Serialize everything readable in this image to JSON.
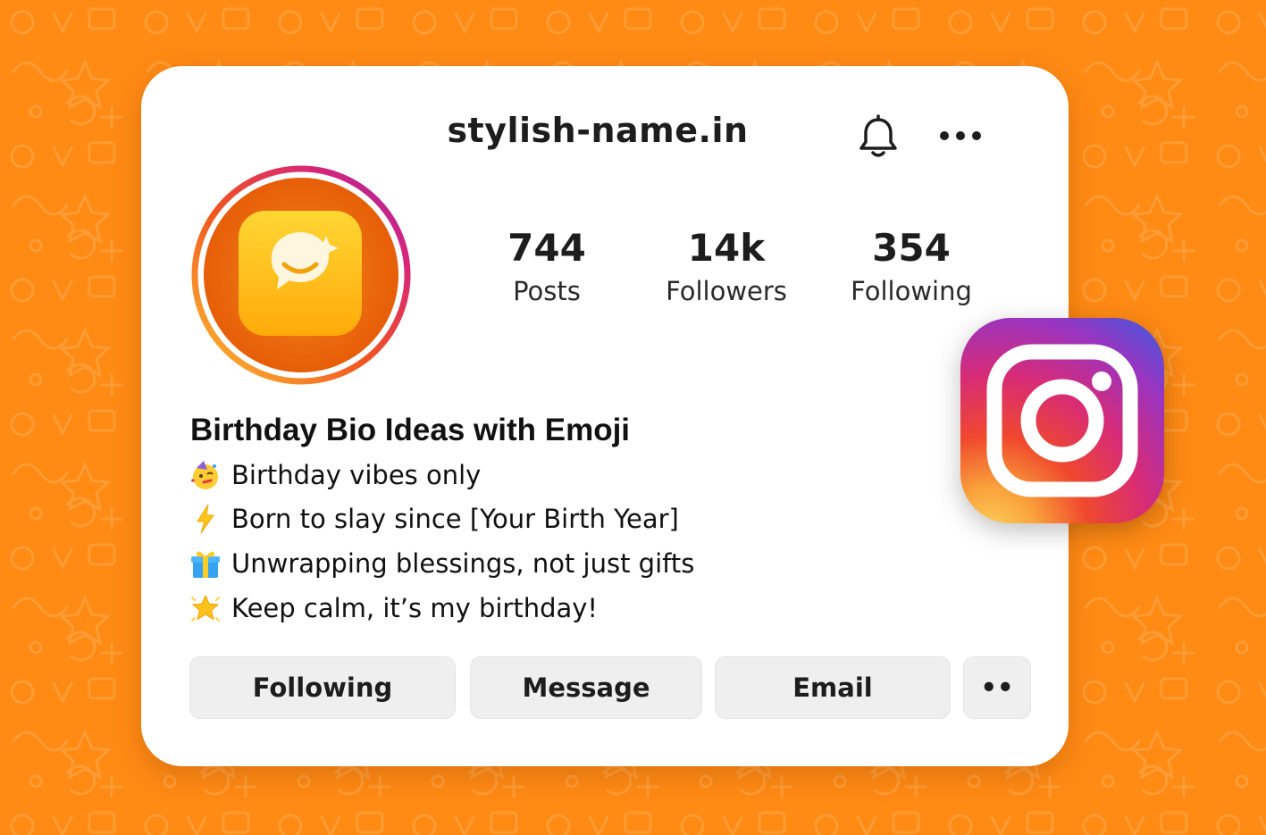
{
  "header": {
    "username": "stylish-name.in",
    "bell_icon": "bell-icon",
    "more_icon": "more-horizontal-icon"
  },
  "stats": [
    {
      "value": "744",
      "label": "Posts"
    },
    {
      "value": "14k",
      "label": "Followers"
    },
    {
      "value": "354",
      "label": "Following"
    }
  ],
  "bio": {
    "title": "Birthday Bio Ideas with Emoji",
    "lines": [
      {
        "emoji": "partying-face-emoji",
        "text": "Birthday vibes only"
      },
      {
        "emoji": "lightning-emoji",
        "text": "Born to slay since [Your Birth Year]"
      },
      {
        "emoji": "gift-emoji",
        "text": "Unwrapping blessings, not just gifts"
      },
      {
        "emoji": "glowing-star-emoji",
        "text": "Keep calm, it’s my birthday!"
      }
    ]
  },
  "actions": {
    "following_label": "Following",
    "message_label": "Message",
    "email_label": "Email",
    "more_label": "••"
  },
  "colors": {
    "background": "#ff8a14",
    "card": "#ffffff",
    "button": "#efefef",
    "text": "#1d1d1d"
  }
}
